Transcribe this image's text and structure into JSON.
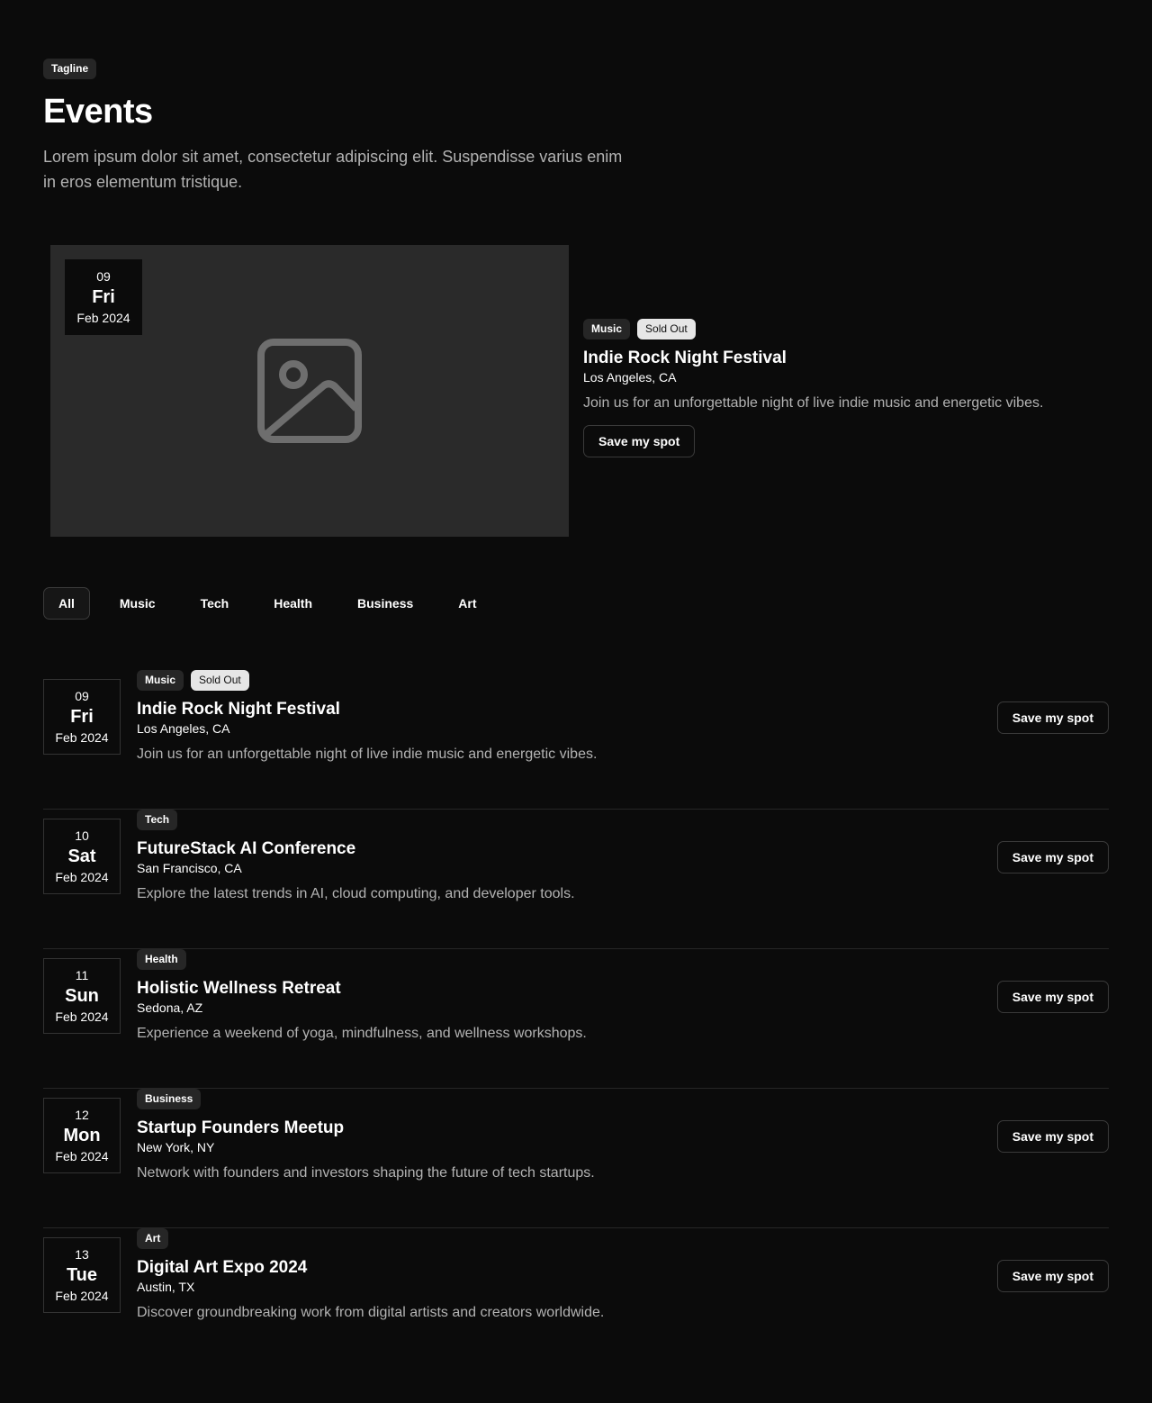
{
  "header": {
    "tagline": "Tagline",
    "title": "Events",
    "intro": "Lorem ipsum dolor sit amet, consectetur adipiscing elit. Suspendisse varius enim in eros elementum tristique."
  },
  "featured": {
    "day": "09",
    "weekday": "Fri",
    "month_year": "Feb 2024",
    "category": "Music",
    "status": "Sold Out",
    "title": "Indie Rock Night Festival",
    "location": "Los Angeles, CA",
    "description": "Join us for an unforgettable night of live indie music and energetic vibes.",
    "button": "Save my spot",
    "image_icon": "image-placeholder-icon"
  },
  "filters": {
    "active": "All",
    "tabs": [
      {
        "label": "All"
      },
      {
        "label": "Music"
      },
      {
        "label": "Tech"
      },
      {
        "label": "Health"
      },
      {
        "label": "Business"
      },
      {
        "label": "Art"
      }
    ]
  },
  "events": [
    {
      "day": "09",
      "weekday": "Fri",
      "month_year": "Feb 2024",
      "category": "Music",
      "status": "Sold Out",
      "title": "Indie Rock Night Festival",
      "location": "Los Angeles, CA",
      "description": "Join us for an unforgettable night of live indie music and energetic vibes.",
      "button": "Save my spot"
    },
    {
      "day": "10",
      "weekday": "Sat",
      "month_year": "Feb 2024",
      "category": "Tech",
      "title": "FutureStack AI Conference",
      "location": "San Francisco, CA",
      "description": "Explore the latest trends in AI, cloud computing, and developer tools.",
      "button": "Save my spot"
    },
    {
      "day": "11",
      "weekday": "Sun",
      "month_year": "Feb 2024",
      "category": "Health",
      "title": "Holistic Wellness Retreat",
      "location": "Sedona, AZ",
      "description": "Experience a weekend of yoga, mindfulness, and wellness workshops.",
      "button": "Save my spot"
    },
    {
      "day": "12",
      "weekday": "Mon",
      "month_year": "Feb 2024",
      "category": "Business",
      "title": "Startup Founders Meetup",
      "location": "New York, NY",
      "description": "Network with founders and investors shaping the future of tech startups.",
      "button": "Save my spot"
    },
    {
      "day": "13",
      "weekday": "Tue",
      "month_year": "Feb 2024",
      "category": "Art",
      "title": "Digital Art Expo 2024",
      "location": "Austin, TX",
      "description": "Discover groundbreaking work from digital artists and creators worldwide.",
      "button": "Save my spot"
    }
  ],
  "colors": {
    "background": "#0b0b0b",
    "placeholder": "#2a2a2a",
    "badge": "#262626",
    "sold_out_badge": "#e6e6e6",
    "muted_text": "#b3b3b3"
  }
}
